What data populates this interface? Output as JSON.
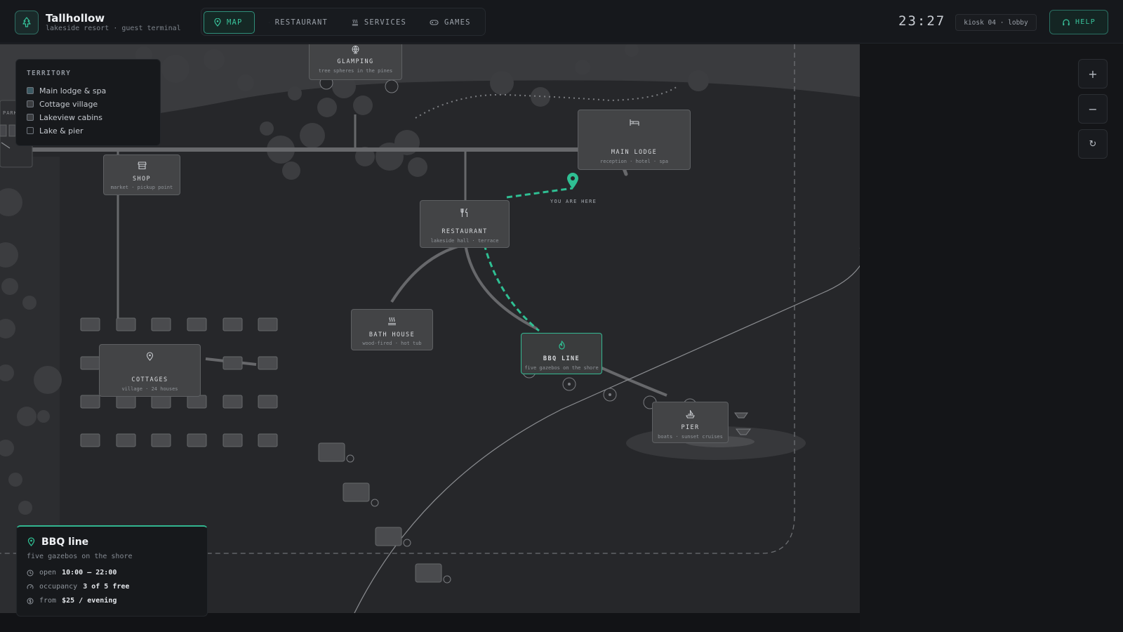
{
  "app": {
    "name": "Tallhollow",
    "subtitle": "lakeside resort · guest terminal"
  },
  "nav": {
    "tabs": [
      {
        "label": "MAP",
        "icon": "map-pin-icon",
        "active": true
      },
      {
        "label": "RESTAURANT",
        "icon": "cutlery-icon",
        "active": false
      },
      {
        "label": "SERVICES",
        "icon": "steam-icon",
        "active": false
      },
      {
        "label": "GAMES",
        "icon": "gamepad-icon",
        "active": false
      }
    ]
  },
  "status": {
    "clock": "23:27",
    "kiosk": "kiosk 04 · lobby",
    "help_label": "HELP"
  },
  "legend": {
    "title": "TERRITORY",
    "items": [
      {
        "label": "Main lodge & spa",
        "color": "#3c5a63"
      },
      {
        "label": "Cottage village",
        "color": "#3b3d40"
      },
      {
        "label": "Lakeview cabins",
        "color": "#3b3d40"
      },
      {
        "label": "Lake & pier",
        "color": "#1c1e21"
      }
    ]
  },
  "map": {
    "nodes": {
      "glamping": {
        "title": "GLAMPING",
        "sub": "tree spheres in the pines",
        "icon": "globe-icon"
      },
      "main_lodge": {
        "title": "MAIN LODGE",
        "sub": "reception · hotel · spa",
        "icon": "bed-icon"
      },
      "shop": {
        "title": "SHOP",
        "sub": "market · pickup point",
        "icon": "store-icon"
      },
      "restaurant": {
        "title": "RESTAURANT",
        "sub": "lakeside hall · terrace",
        "icon": "cutlery-icon"
      },
      "bath_house": {
        "title": "BATH HOUSE",
        "sub": "wood-fired · hot tub",
        "icon": "steam-icon"
      },
      "bbq_line": {
        "title": "BBQ LINE",
        "sub": "five gazebos on the shore",
        "icon": "flame-icon",
        "selected": true
      },
      "cottages": {
        "title": "COTTAGES",
        "sub": "village · 24 houses",
        "icon": "map-pin-icon"
      },
      "pier": {
        "title": "PIER",
        "sub": "boats · sunset cruises",
        "icon": "boat-icon"
      }
    },
    "you_are_here": "YOU ARE HERE",
    "parking_label": "PARK",
    "accent_color": "#2fbf93"
  },
  "zoom": {
    "in": "+",
    "out": "−",
    "reset": "↻"
  },
  "info": {
    "title": "BBQ line",
    "subtitle": "five gazebos on the shore",
    "rows": [
      {
        "label": "open",
        "value": "10:00 – 22:00",
        "icon": "clock-icon"
      },
      {
        "label": "occupancy",
        "value": "3 of 5 free",
        "icon": "gauge-icon"
      },
      {
        "label": "from",
        "value": "$25 / evening",
        "icon": "coin-icon"
      }
    ]
  }
}
